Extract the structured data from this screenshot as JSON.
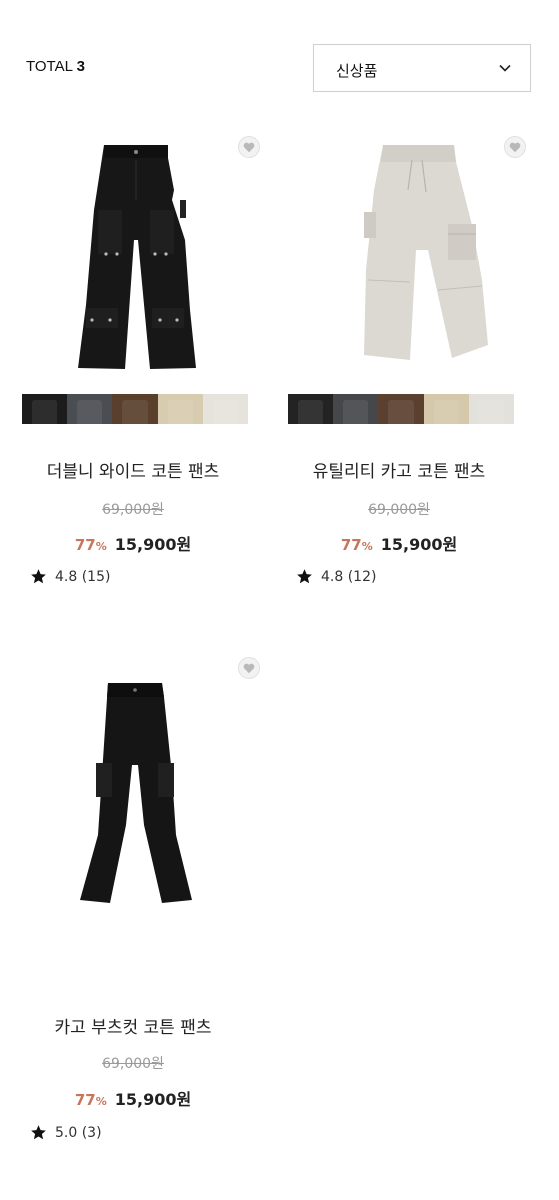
{
  "header": {
    "total_label": "TOTAL",
    "total_count": "3",
    "sort_selected": "신상품",
    "sort_icon": "chevron-down-icon"
  },
  "products": [
    {
      "name": "더블니 와이드 코튼 팬츠",
      "original_price": "69,000원",
      "discount": "77",
      "discount_unit": "%",
      "price": "15,900원",
      "rating": "4.8",
      "reviews": "(15)",
      "image": "black wide-leg cotton pants",
      "swatch_colors": [
        "#1c1c1c",
        "#4a4d52",
        "#5a3f2c",
        "#d8ccb0",
        "#e6e3dc"
      ]
    },
    {
      "name": "유틸리티 카고 코튼 팬츠",
      "original_price": "69,000원",
      "discount": "77",
      "discount_unit": "%",
      "price": "15,900원",
      "rating": "4.8",
      "reviews": "(12)",
      "image": "light grey cargo cotton pants",
      "swatch_colors": [
        "#232323",
        "#45474b",
        "#5b3f2f",
        "#d6c9ab",
        "#e3e1dc"
      ]
    },
    {
      "name": "카고 부츠컷 코튼 팬츠",
      "original_price": "69,000원",
      "discount": "77",
      "discount_unit": "%",
      "price": "15,900원",
      "rating": "5.0",
      "reviews": "(3)",
      "image": "black bootcut cargo pants"
    }
  ],
  "colors": {
    "discount": "#c9755b",
    "original_price": "#9a9a9a",
    "border": "#cfcfcf"
  },
  "icons": {
    "wishlist": "heart-icon",
    "rating": "star-icon"
  }
}
